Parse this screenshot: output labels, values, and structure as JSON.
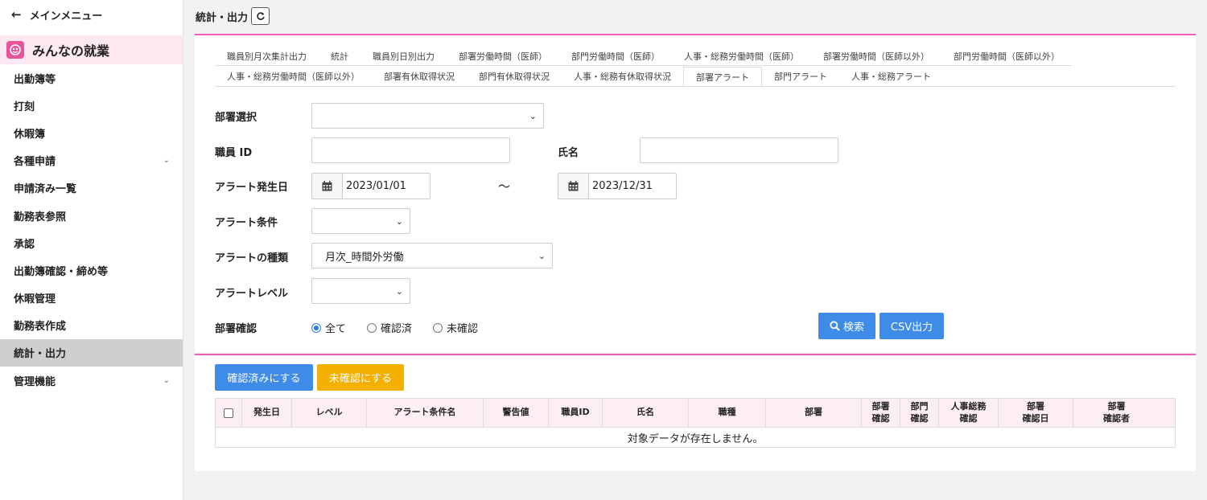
{
  "sidebar": {
    "main_menu": "メインメニュー",
    "app_name": "みんなの就業",
    "items": [
      {
        "label": "出勤簿等",
        "has_sub": false,
        "active": false
      },
      {
        "label": "打刻",
        "has_sub": false,
        "active": false
      },
      {
        "label": "休暇簿",
        "has_sub": false,
        "active": false
      },
      {
        "label": "各種申請",
        "has_sub": true,
        "active": false
      },
      {
        "label": "申請済み一覧",
        "has_sub": false,
        "active": false
      },
      {
        "label": "勤務表参照",
        "has_sub": false,
        "active": false
      },
      {
        "label": "承認",
        "has_sub": false,
        "active": false
      },
      {
        "label": "出勤簿確認・締め等",
        "has_sub": false,
        "active": false
      },
      {
        "label": "休暇管理",
        "has_sub": false,
        "active": false
      },
      {
        "label": "勤務表作成",
        "has_sub": false,
        "active": false
      },
      {
        "label": "統計・出力",
        "has_sub": false,
        "active": true
      },
      {
        "label": "管理機能",
        "has_sub": true,
        "active": false
      }
    ]
  },
  "header": {
    "title": "統計・出力"
  },
  "tabs_row1": [
    "職員別月次集計出力",
    "統計",
    "職員別日別出力",
    "部署労働時間（医師）",
    "部門労働時間（医師）",
    "人事・総務労働時間（医師）",
    "部署労働時間（医師以外）",
    "部門労働時間（医師以外）"
  ],
  "tabs_row2": [
    "人事・総務労働時間（医師以外）",
    "部署有休取得状況",
    "部門有休取得状況",
    "人事・総務有休取得状況",
    "部署アラート",
    "部門アラート",
    "人事・総務アラート"
  ],
  "active_tab": "部署アラート",
  "form": {
    "dept_label": "部署選択",
    "dept_value": "",
    "staff_id_label": "職員 ID",
    "staff_id_value": "",
    "name_label": "氏名",
    "name_value": "",
    "alert_date_label": "アラート発生日",
    "date_from": "2023/01/01",
    "date_sep": "～",
    "date_to": "2023/12/31",
    "condition_label": "アラート条件",
    "condition_value": "",
    "type_label": "アラートの種類",
    "type_value": "月次_時間外労働",
    "level_label": "アラートレベル",
    "level_value": "",
    "confirm_label": "部署確認",
    "radio_all": "全て",
    "radio_confirmed": "確認済",
    "radio_unconfirmed": "未確認",
    "search_button": "検索",
    "csv_button": "CSV出力"
  },
  "actions": {
    "mark_confirmed": "確認済みにする",
    "mark_unconfirmed": "未確認にする"
  },
  "table": {
    "headers": [
      "発生日",
      "レベル",
      "アラート条件名",
      "警告値",
      "職員ID",
      "氏名",
      "職種",
      "部署",
      "部署\n確認",
      "部門\n確認",
      "人事総務\n確認",
      "部署\n確認日",
      "部署\n確認者"
    ],
    "empty_message": "対象データが存在しません。"
  }
}
